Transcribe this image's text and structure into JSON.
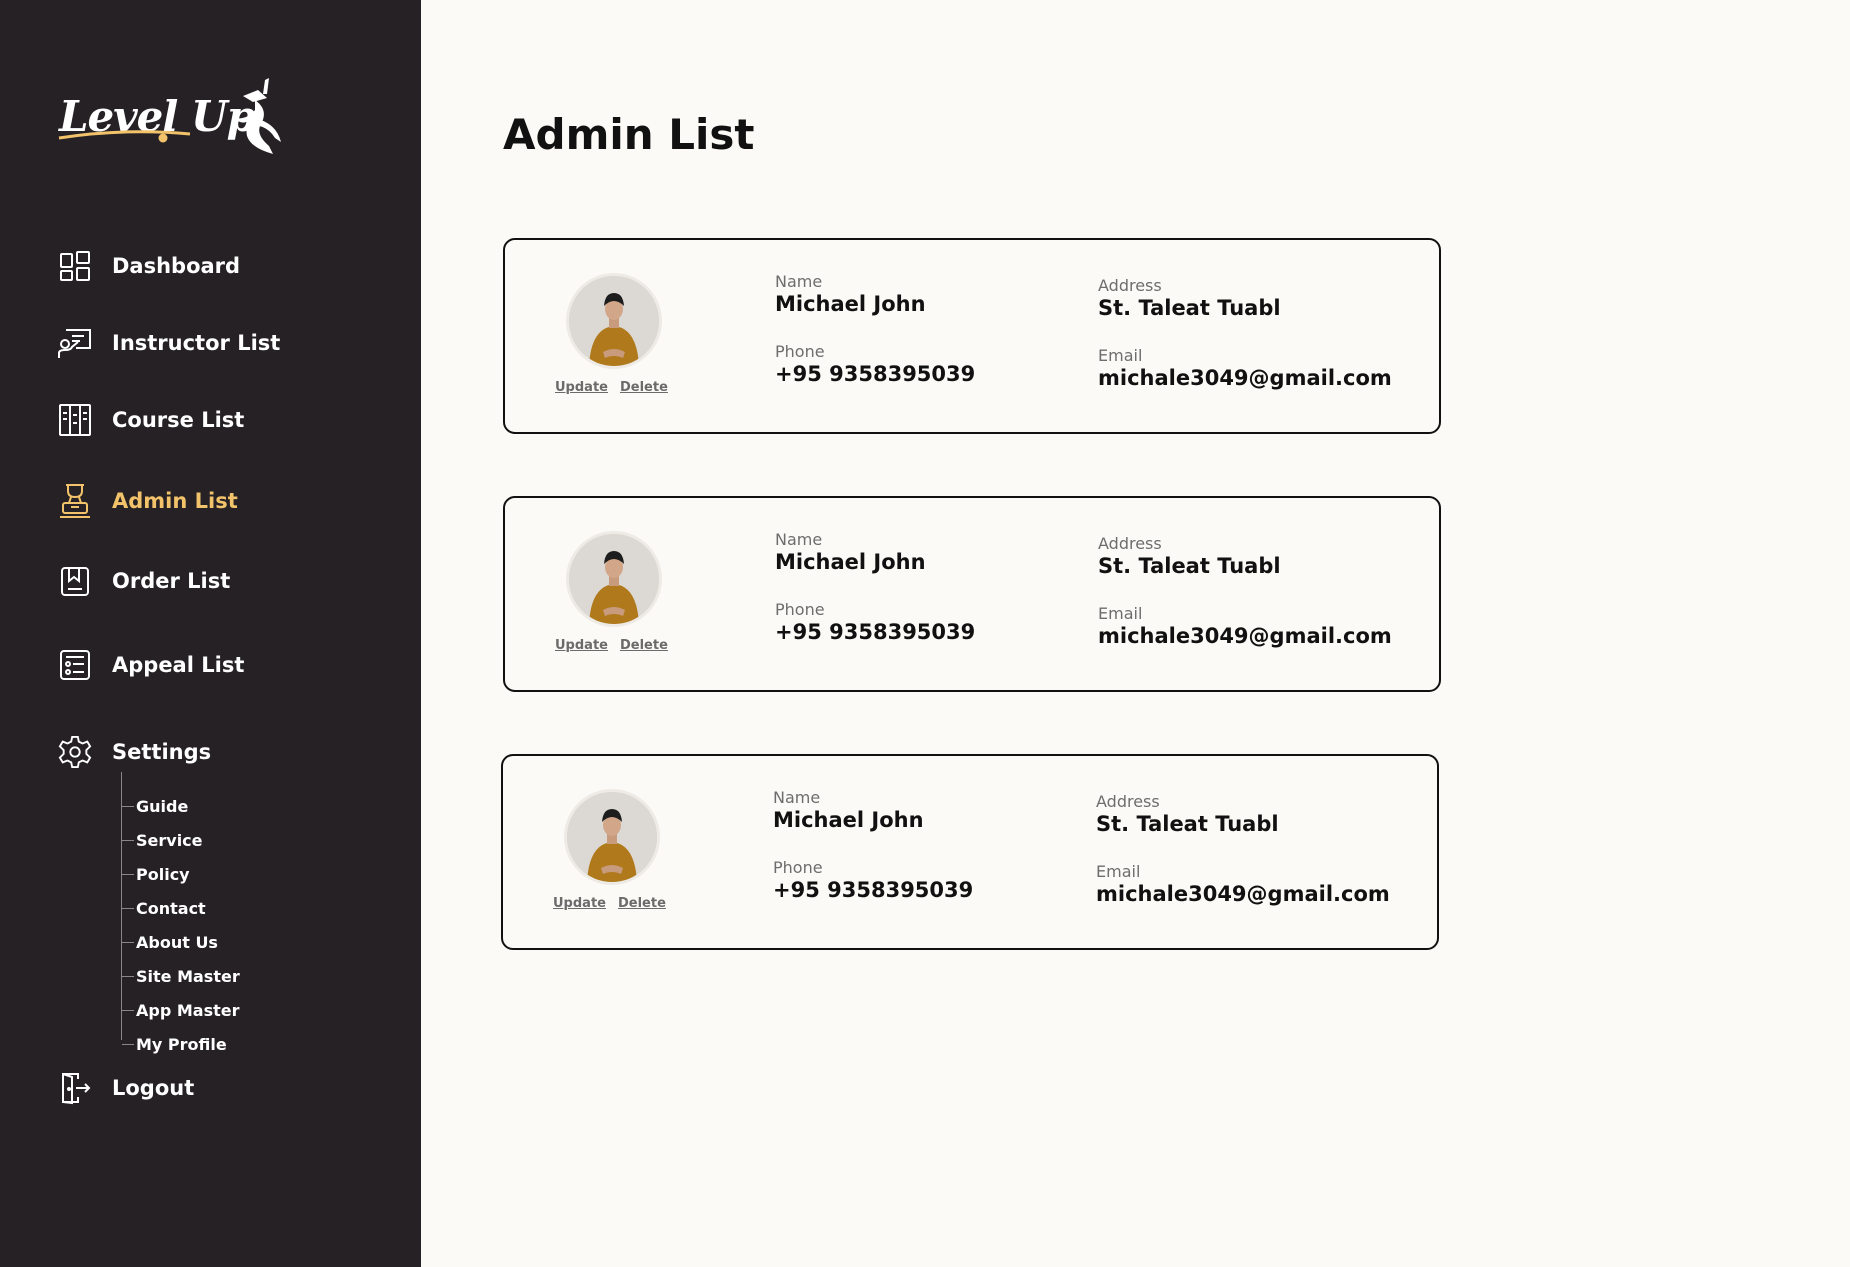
{
  "brand": {
    "logo_text": "Level Up",
    "accent_color": "#f2c36b",
    "sidebar_bg": "#252124"
  },
  "nav": [
    {
      "label": "Dashboard",
      "icon": "dashboard-grid-icon",
      "active": false
    },
    {
      "label": "Instructor List",
      "icon": "instructor-board-icon",
      "active": false
    },
    {
      "label": "Course List",
      "icon": "course-book-icon",
      "active": false
    },
    {
      "label": "Admin List",
      "icon": "admin-user-icon",
      "active": true
    },
    {
      "label": "Order List",
      "icon": "order-bookmark-icon",
      "active": false
    },
    {
      "label": "Appeal List",
      "icon": "appeal-list-icon",
      "active": false
    },
    {
      "label": "Settings",
      "icon": "gear-icon",
      "active": false
    }
  ],
  "settings_sub": [
    "Guide",
    "Service",
    "Policy",
    "Contact",
    "About Us",
    "Site Master",
    "App Master",
    "My Profile"
  ],
  "logout": {
    "label": "Logout",
    "icon": "logout-door-icon"
  },
  "page": {
    "title": "Admin List"
  },
  "field_labels": {
    "name": "Name",
    "phone": "Phone",
    "address": "Address",
    "email": "Email"
  },
  "actions": {
    "update": "Update",
    "delete": "Delete"
  },
  "admins": [
    {
      "name": "Michael John",
      "phone": "+95 9358395039",
      "address": "St.  Taleat Tuabl",
      "email": "michale3049@gmail.com"
    },
    {
      "name": "Michael John",
      "phone": "+95 9358395039",
      "address": "St.  Taleat Tuabl",
      "email": "michale3049@gmail.com"
    },
    {
      "name": "Michael John",
      "phone": "+95 9358395039",
      "address": "St.  Taleat Tuabl",
      "email": "michale3049@gmail.com"
    }
  ]
}
